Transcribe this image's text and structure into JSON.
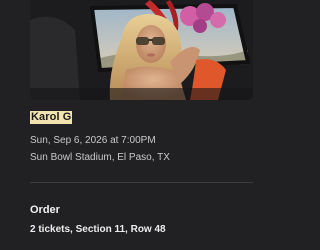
{
  "event": {
    "artist": "Karol G",
    "datetime": "Sun, Sep 6, 2026 at 7:00PM",
    "venue": "Sun Bowl Stadium, El Paso, TX",
    "image_alt": "Karol G promotional photo"
  },
  "order": {
    "heading": "Order",
    "details": "2 tickets, Section 11, Row 48"
  },
  "colors": {
    "background": "#212123",
    "artist_highlight": "#f2e4b0",
    "text_secondary": "#c9c9cd",
    "text_primary": "#f2f2f2"
  }
}
